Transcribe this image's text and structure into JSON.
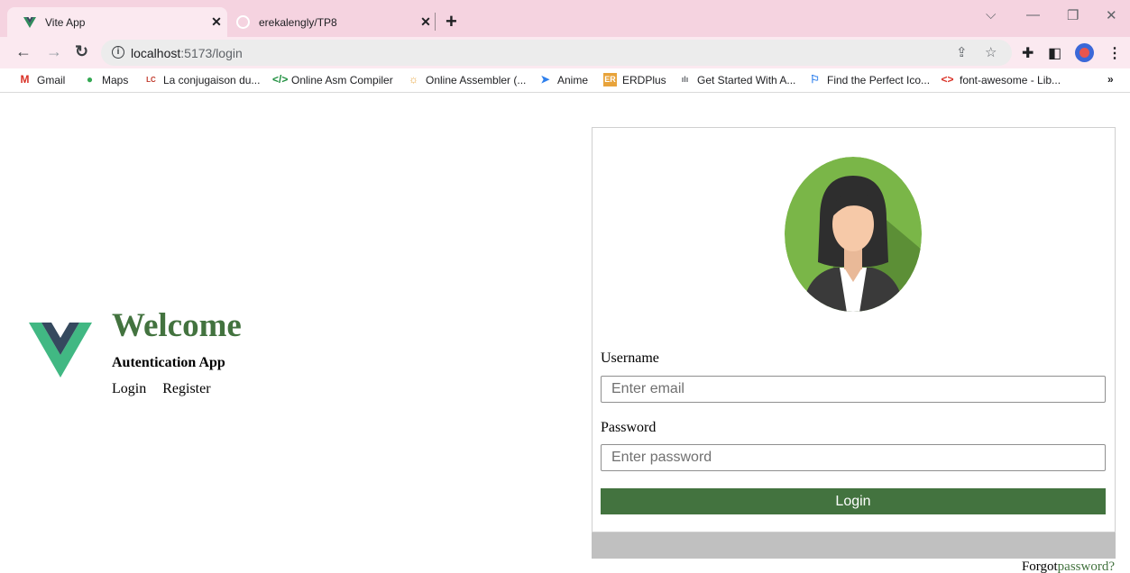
{
  "browser": {
    "tabs": [
      {
        "title": "Vite App",
        "icon": "vue-icon",
        "active": true
      },
      {
        "title": "erekalengly/TP8",
        "icon": "github-icon",
        "active": false
      }
    ],
    "url_host": "localhost",
    "url_port_path": ":5173/login",
    "bookmarks": [
      {
        "label": "Gmail",
        "icon": "gmail-icon",
        "color": "#d93025"
      },
      {
        "label": "Maps",
        "icon": "maps-icon",
        "color": "#34a853"
      },
      {
        "label": "La conjugaison du...",
        "icon": "conjugaison-icon",
        "color": "#c0392b"
      },
      {
        "label": "Online Asm Compiler",
        "icon": "code-icon",
        "color": "#1e8e3e"
      },
      {
        "label": "Online Assembler (...",
        "icon": "sun-icon",
        "color": "#e8a33a"
      },
      {
        "label": "Anime",
        "icon": "paper-plane-icon",
        "color": "#2f80ed"
      },
      {
        "label": "ERDPlus",
        "icon": "erdplus-icon",
        "color": "#e8a33a"
      },
      {
        "label": "Get Started With A...",
        "icon": "cisco-icon",
        "color": "#5f6368"
      },
      {
        "label": "Find the Perfect Ico...",
        "icon": "flag-icon",
        "color": "#2f80ed"
      },
      {
        "label": "font-awesome - Lib...",
        "icon": "brackets-icon",
        "color": "#d93025"
      }
    ],
    "bookmarks_overflow": "»"
  },
  "app": {
    "welcome": "Welcome",
    "subtitle": "Autentication App",
    "nav": {
      "login": "Login",
      "register": "Register"
    },
    "form": {
      "username_label": "Username",
      "username_placeholder": "Enter email",
      "password_label": "Password",
      "password_placeholder": "Enter password",
      "login_button": "Login",
      "forgot_prefix": "Forgot",
      "forgot_link": "password?"
    },
    "colors": {
      "primary": "#43733f",
      "vue_green": "#41b883",
      "vue_dark": "#35495e"
    }
  }
}
